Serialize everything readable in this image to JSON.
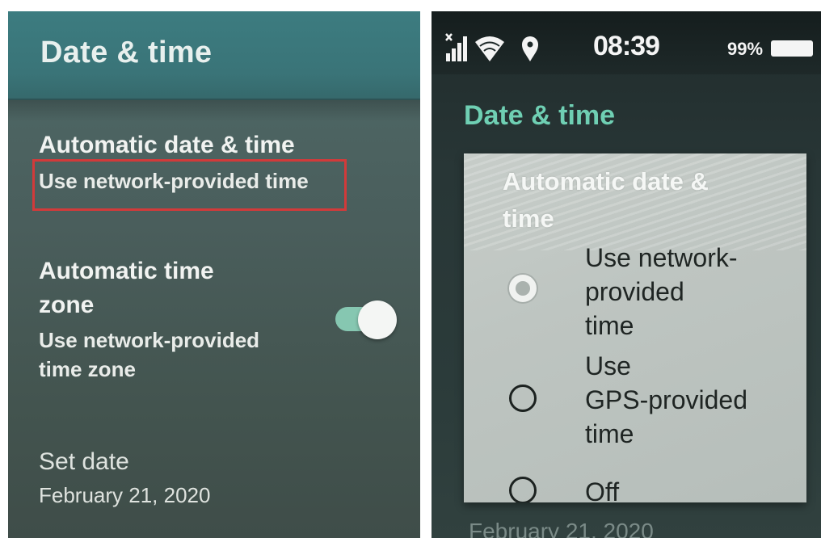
{
  "left_screen": {
    "title": "Date & time",
    "automatic_datetime": {
      "title": "Automatic date & time",
      "subtitle": "Use network-provided time",
      "highlighted": true
    },
    "automatic_timezone": {
      "title_line1": "Automatic time",
      "title_line2": "zone",
      "subtitle_line1": "Use network-provided",
      "subtitle_line2": "time zone",
      "toggle_on": true
    },
    "set_date": {
      "title": "Set date",
      "value": "February 21, 2020"
    }
  },
  "right_screen": {
    "status_bar": {
      "time": "08:39",
      "battery": "99%",
      "icons": [
        "signal-icon",
        "wifi-icon",
        "location-icon",
        "battery-icon"
      ]
    },
    "title": "Date & time",
    "dialog": {
      "title_line1": "Automatic date &",
      "title_line2": "time",
      "options": [
        {
          "lines": [
            "Use network-",
            "provided",
            "time"
          ],
          "selected": true
        },
        {
          "lines": [
            "Use",
            "GPS-provided",
            "time"
          ],
          "selected": false
        },
        {
          "lines": [
            "Off"
          ],
          "selected": false
        }
      ]
    },
    "behind_text": "February 21, 2020"
  },
  "colors": {
    "accent_teal": "#6fcfb3",
    "toggle_track": "#86c7b1",
    "highlight_red": "#d23a3a",
    "header_teal": "#3a7478"
  }
}
